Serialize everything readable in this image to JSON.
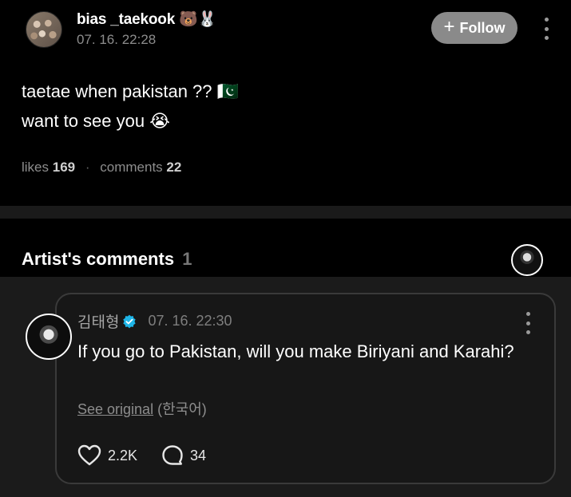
{
  "post": {
    "username": "bias _taekook 🐻🐰",
    "timestamp": "07. 16. 22:28",
    "follow_label": "Follow",
    "text_line1": "taetae when pakistan ?? 🇵🇰",
    "text_line2": "want to see you 😭",
    "likes_label": "likes",
    "likes_count": "169",
    "comments_label": "comments",
    "comments_count": "22"
  },
  "artist_comments": {
    "title": "Artist's comments",
    "count": "1"
  },
  "comment": {
    "author": "김태형",
    "timestamp": "07. 16. 22:30",
    "text": "If you go to Pakistan, will you make Biriyani and Karahi?",
    "see_original_label": "See original",
    "language": "(한국어)",
    "likes": "2.2K",
    "replies": "34"
  },
  "colors": {
    "verified": "#1fb6e8",
    "follow_bg": "#8a8a8a",
    "card_border": "#3a3a3a"
  },
  "icons": [
    "plus-icon",
    "more-vertical-icon",
    "verified-badge-icon",
    "heart-icon",
    "comment-bubble-icon"
  ]
}
